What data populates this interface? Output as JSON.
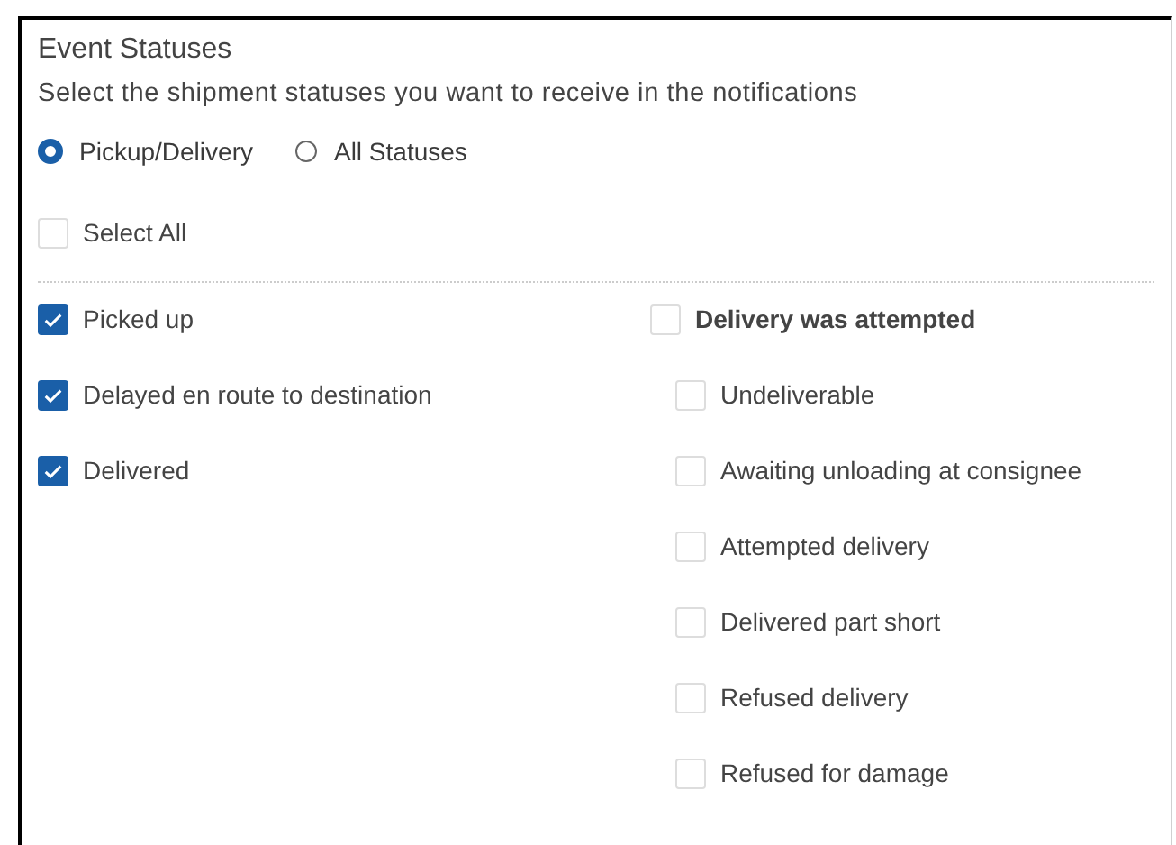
{
  "title": "Event Statuses",
  "subtitle": "Select the shipment statuses you want to receive in the notifications",
  "modes": [
    {
      "label": "Pickup/Delivery",
      "selected": true
    },
    {
      "label": "All Statuses",
      "selected": false
    }
  ],
  "select_all": {
    "label": "Select All",
    "checked": false
  },
  "left_statuses": [
    {
      "label": "Picked up",
      "checked": true
    },
    {
      "label": "Delayed en route to destination",
      "checked": true
    },
    {
      "label": "Delivered",
      "checked": true
    }
  ],
  "right_statuses": [
    {
      "label": "Delivery was attempted",
      "checked": false,
      "children": [
        {
          "label": "Undeliverable",
          "checked": false
        },
        {
          "label": "Awaiting unloading at consignee",
          "checked": false
        },
        {
          "label": "Attempted delivery",
          "checked": false
        },
        {
          "label": "Delivered part short",
          "checked": false
        },
        {
          "label": "Refused delivery",
          "checked": false
        },
        {
          "label": "Refused for damage",
          "checked": false
        }
      ]
    }
  ]
}
